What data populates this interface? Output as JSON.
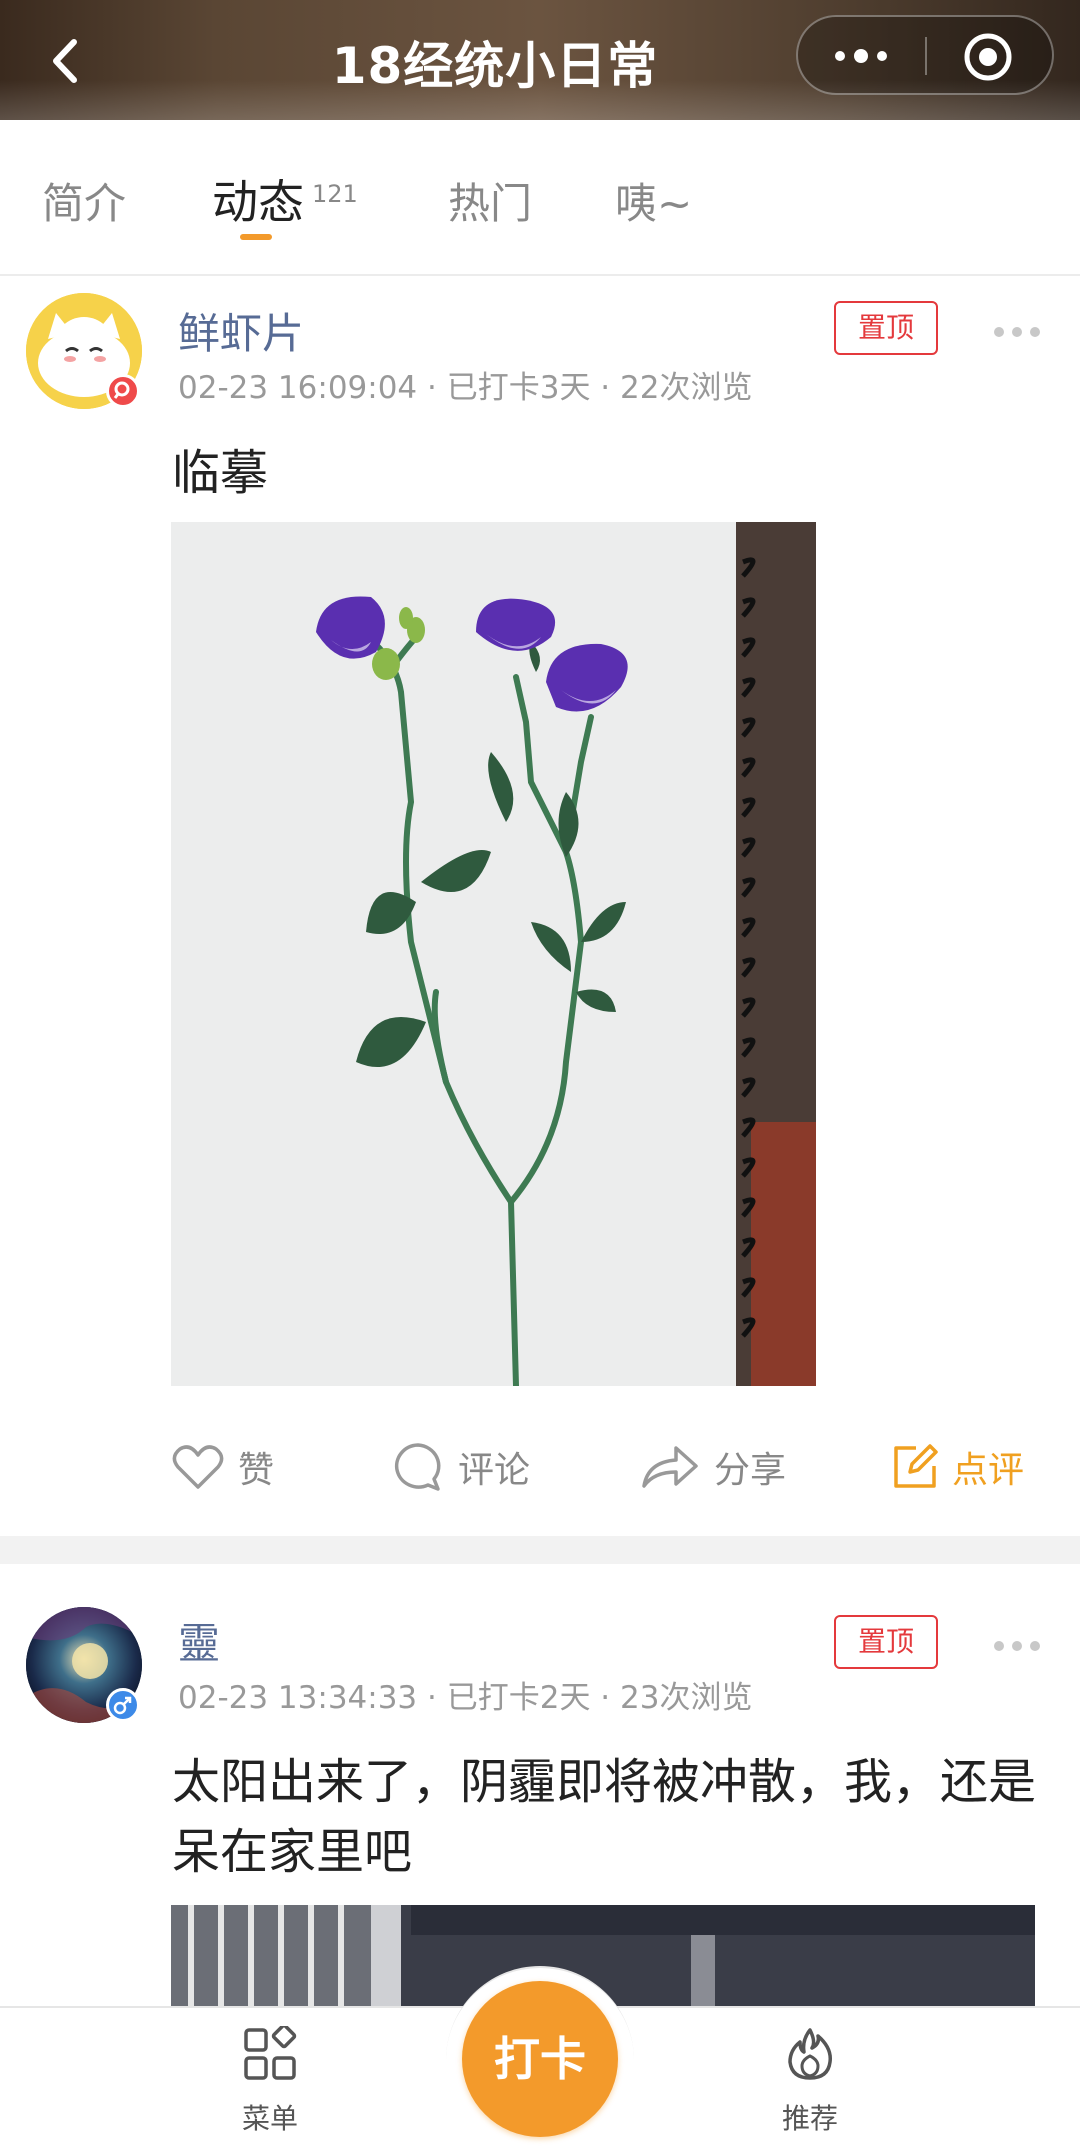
{
  "header": {
    "title": "18经统小日常",
    "back_icon": "chevron-left-icon",
    "more_icon": "more-dots-icon",
    "close_icon": "target-close-icon"
  },
  "tabs": [
    {
      "label": "简介",
      "count": ""
    },
    {
      "label": "动态",
      "count": "121",
      "active": true
    },
    {
      "label": "热门",
      "count": ""
    },
    {
      "label": "咦~",
      "count": ""
    }
  ],
  "posts": [
    {
      "username": "鲜虾片",
      "meta": "02-23 16:09:04 · 已打卡3天 · 22次浏览",
      "pin_label": "置顶",
      "text": "临摹",
      "avatar_badge_icon": "search-badge-icon",
      "actions": {
        "like": "赞",
        "comment": "评论",
        "share": "分享",
        "review": "点评"
      }
    },
    {
      "username": "靈",
      "meta": "02-23 13:34:33 · 已打卡2天 · 23次浏览",
      "pin_label": "置顶",
      "text": "太阳出来了，阴霾即将被冲散，我，还是呆在家里吧",
      "avatar_badge_icon": "male-badge-icon"
    }
  ],
  "tabbar": {
    "menu_label": "菜单",
    "checkin_label": "打卡",
    "recommend_label": "推荐"
  },
  "colors": {
    "accent": "#f39a2b",
    "link": "#576b95",
    "pin": "#e4393c",
    "review": "#f0a020"
  }
}
